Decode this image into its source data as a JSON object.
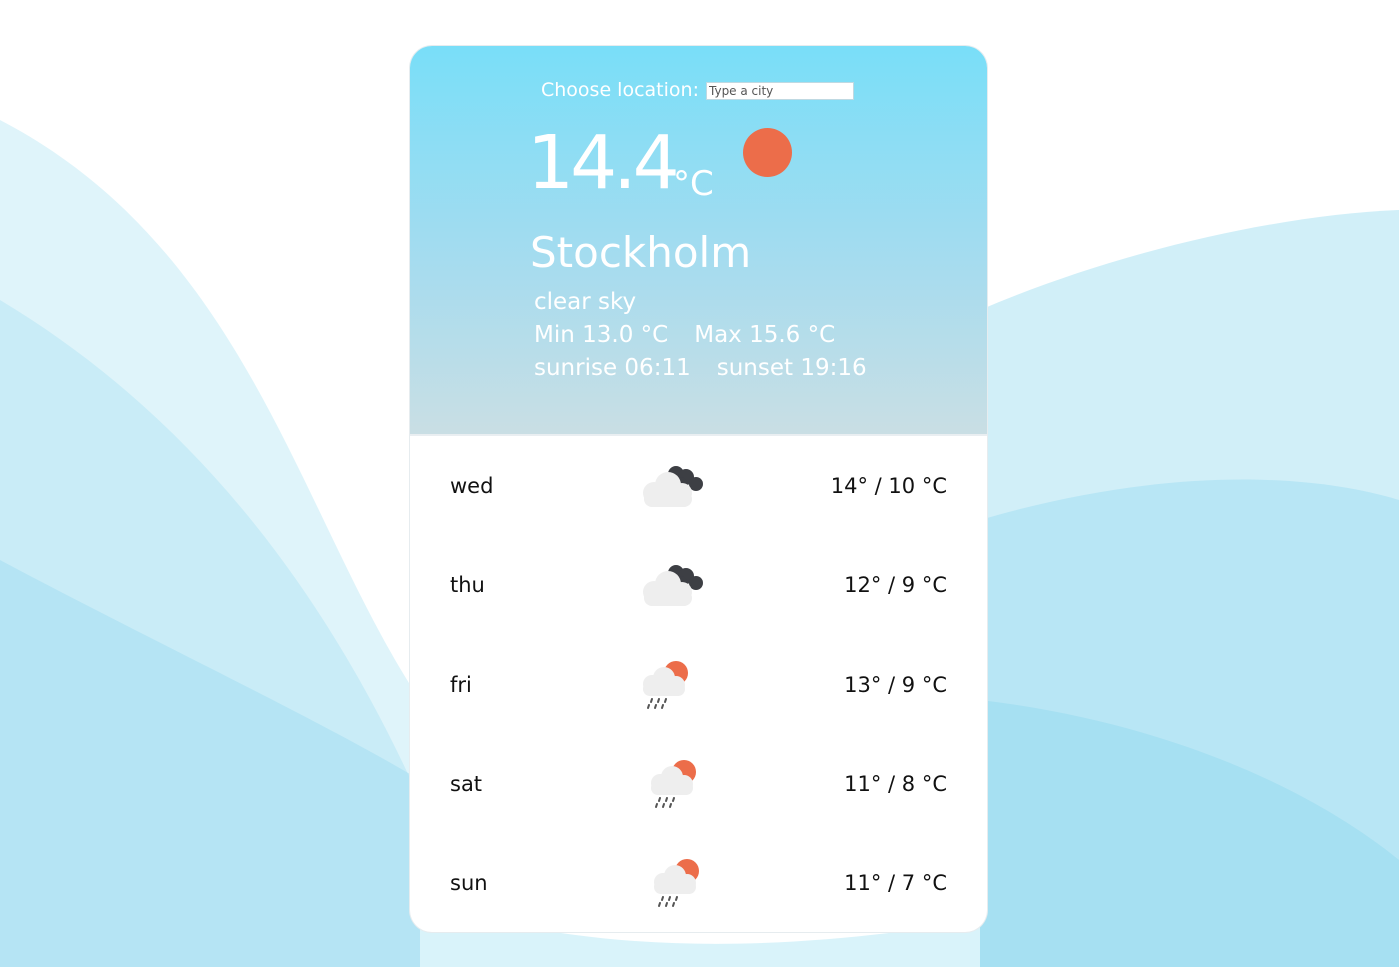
{
  "location": {
    "label": "Choose location:",
    "placeholder": "Type a city",
    "value": ""
  },
  "current": {
    "temperature": "14.4",
    "unit": "°C",
    "city": "Stockholm",
    "description": "clear sky",
    "min": "Min 13.0 °C",
    "max": "Max 15.6 °C",
    "sunrise": "sunrise 06:11",
    "sunset": "sunset 19:16",
    "icon": "sun-icon",
    "sun_color": "#ec6d4a"
  },
  "forecast": [
    {
      "day": "wed",
      "icon": "cloudy-icon",
      "temps": "14° / 10 °C"
    },
    {
      "day": "thu",
      "icon": "cloudy-icon",
      "temps": "12° / 9 °C"
    },
    {
      "day": "fri",
      "icon": "sun-rain-icon",
      "temps": "13° / 9 °C"
    },
    {
      "day": "sat",
      "icon": "sun-rain-icon",
      "temps": "11° / 8 °C"
    },
    {
      "day": "sun",
      "icon": "sun-rain-icon",
      "temps": "11° / 7 °C"
    }
  ],
  "colors": {
    "header_top": "#79def8",
    "header_bottom": "#c9dee4",
    "accent": "#ec6d4a"
  }
}
